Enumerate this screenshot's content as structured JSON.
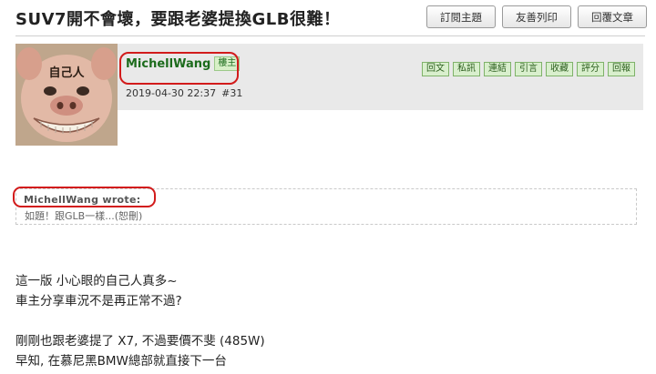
{
  "thread": {
    "title": "SUV7開不會壞，要跟老婆提換GLB很難！",
    "actions": [
      "訂閱主題",
      "友善列印",
      "回覆文章"
    ]
  },
  "post": {
    "avatar_caption": "自己人",
    "author": "MichellWang",
    "badge": "樓主",
    "time": "2019-04-30 22:37",
    "floor": "#31",
    "actions": [
      "回文",
      "私訊",
      "連結",
      "引言",
      "收藏",
      "評分",
      "回報"
    ]
  },
  "quote": {
    "author": "MichellWang wrote:",
    "text": "如題！跟GLB一樣...(恕刪)"
  },
  "body": {
    "lines": [
      "這一版 小心眼的自己人真多~",
      "車主分享車況不是再正常不過?",
      "",
      "剛剛也跟老婆提了 X7, 不過要價不斐 (485W)",
      "早知, 在慕尼黑BMW總部就直接下一台"
    ]
  },
  "colors": {
    "highlight_circle": "#d21b1b",
    "author_green": "#1c6b1c",
    "meta_background": "#e9e9e9"
  }
}
